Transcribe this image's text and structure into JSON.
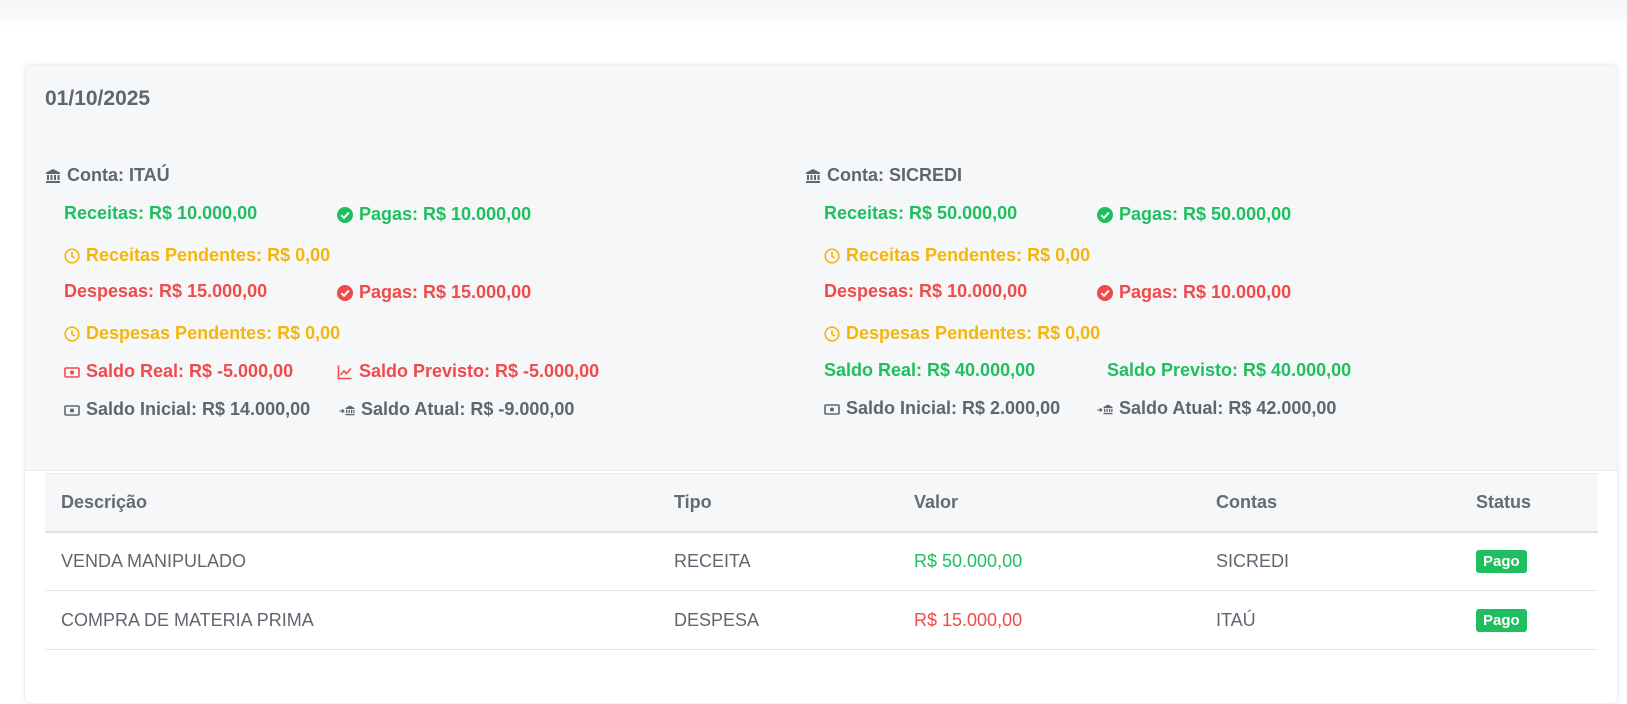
{
  "date": "01/10/2025",
  "colors": {
    "green": "#1fbf5f",
    "red": "#ef4b4b",
    "amber": "#f5b50a",
    "gray": "#5f6670"
  },
  "accounts": [
    {
      "title": "Conta: ITAÚ",
      "receitas": "Receitas: R$ 10.000,00",
      "receitas_pagas": "Pagas: R$ 10.000,00",
      "receitas_pendentes": "Receitas Pendentes: R$ 0,00",
      "despesas": "Despesas: R$ 15.000,00",
      "despesas_pagas": "Pagas: R$ 15.000,00",
      "despesas_pendentes": "Despesas Pendentes: R$ 0,00",
      "saldo_real": "Saldo Real: R$ -5.000,00",
      "saldo_previsto": "Saldo Previsto: R$ -5.000,00",
      "saldo_inicial": "Saldo Inicial: R$ 14.000,00",
      "saldo_atual": "Saldo Atual: R$ -9.000,00"
    },
    {
      "title": "Conta: SICREDI",
      "receitas": "Receitas: R$ 50.000,00",
      "receitas_pagas": "Pagas: R$ 50.000,00",
      "receitas_pendentes": "Receitas Pendentes: R$ 0,00",
      "despesas": "Despesas: R$ 10.000,00",
      "despesas_pagas": "Pagas: R$ 10.000,00",
      "despesas_pendentes": "Despesas Pendentes: R$ 0,00",
      "saldo_real": "Saldo Real: R$ 40.000,00",
      "saldo_previsto": "Saldo Previsto: R$ 40.000,00",
      "saldo_inicial": "Saldo Inicial: R$ 2.000,00",
      "saldo_atual": "Saldo Atual: R$ 42.000,00"
    }
  ],
  "table": {
    "headers": [
      "Descrição",
      "Tipo",
      "Valor",
      "Contas",
      "Status"
    ],
    "rows": [
      {
        "descricao": "VENDA MANIPULADO",
        "tipo": "RECEITA",
        "valor": "R$ 50.000,00",
        "conta": "SICREDI",
        "status": "Pago"
      },
      {
        "descricao": "COMPRA DE MATERIA PRIMA",
        "tipo": "DESPESA",
        "valor": "R$ 15.000,00",
        "conta": "ITAÚ",
        "status": "Pago"
      }
    ]
  }
}
